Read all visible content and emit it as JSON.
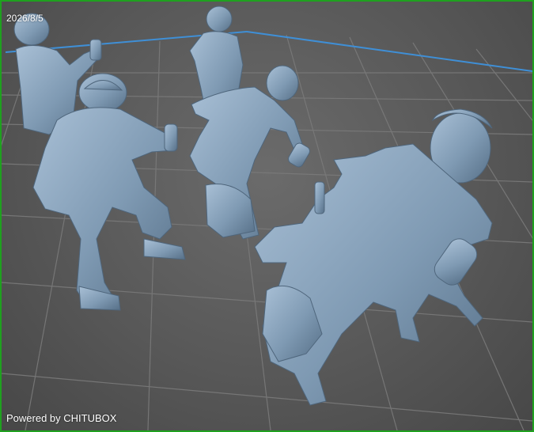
{
  "viewport": {
    "date_text": "2026/8/5",
    "watermark_text": "Powered by CHITUBOX",
    "border_color": "#1fa11f",
    "model_color": "#7f9ab3",
    "plate_outline_color": "#3f8fd6"
  },
  "models": [
    {
      "name": "figure-boy-spraying-back-left"
    },
    {
      "name": "figure-crouching-cap-spraying"
    },
    {
      "name": "figure-standing-kid-center"
    },
    {
      "name": "figure-girl-dancing-can"
    },
    {
      "name": "figure-girl-crouching-front-right"
    }
  ]
}
